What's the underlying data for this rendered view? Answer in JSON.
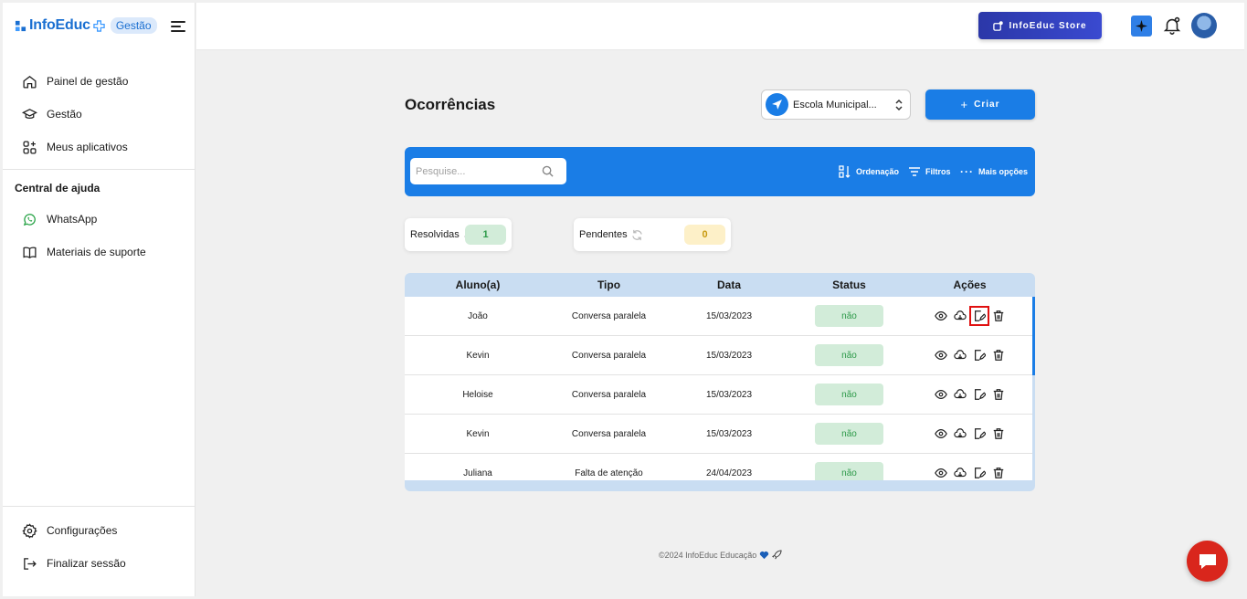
{
  "brand": {
    "name": "InfoEduc",
    "badge": "Gestão"
  },
  "sidebar": {
    "items": [
      {
        "label": "Painel de gestão",
        "icon": "home-icon"
      },
      {
        "label": "Gestão",
        "icon": "graduation-cap-icon"
      },
      {
        "label": "Meus aplicativos",
        "icon": "apps-icon"
      }
    ],
    "help_title": "Central de ajuda",
    "help_items": [
      {
        "label": "WhatsApp",
        "icon": "whatsapp-icon"
      },
      {
        "label": "Materiais de suporte",
        "icon": "book-icon"
      }
    ],
    "bottom_items": [
      {
        "label": "Configurações",
        "icon": "gear-icon"
      },
      {
        "label": "Finalizar sessão",
        "icon": "logout-icon"
      }
    ]
  },
  "topbar": {
    "store_label": "InfoEduc Store"
  },
  "main": {
    "title": "Ocorrências",
    "school_select": "Escola Municipal...",
    "create_label": "Criar",
    "search_placeholder": "Pesquise...",
    "bar_options": {
      "sort": "Ordenação",
      "filters": "Filtros",
      "more": "Mais opções"
    },
    "stats": [
      {
        "label": "Resolvidas",
        "value": "1",
        "color": "#d2ecd9",
        "text_color": "#2e9a4a"
      },
      {
        "label": "Pendentes",
        "value": "0",
        "color": "#fdf0c8",
        "text_color": "#c89a10"
      }
    ],
    "table": {
      "headers": [
        "Aluno(a)",
        "Tipo",
        "Data",
        "Status",
        "Ações"
      ],
      "rows": [
        {
          "aluno": "João",
          "tipo": "Conversa paralela",
          "data": "15/03/2023",
          "status": "não"
        },
        {
          "aluno": "Kevin",
          "tipo": "Conversa paralela",
          "data": "15/03/2023",
          "status": "não"
        },
        {
          "aluno": "Heloise",
          "tipo": "Conversa paralela",
          "data": "15/03/2023",
          "status": "não"
        },
        {
          "aluno": "Kevin",
          "tipo": "Conversa paralela",
          "data": "15/03/2023",
          "status": "não"
        },
        {
          "aluno": "Juliana",
          "tipo": "Falta de atenção",
          "data": "24/04/2023",
          "status": "não"
        }
      ]
    }
  },
  "footer": {
    "text": "©2024 InfoEduc Educação"
  },
  "colors": {
    "primary": "#1a7de6",
    "store": "#2b37a8",
    "chat": "#d9261c",
    "highlight": "#e01010"
  }
}
